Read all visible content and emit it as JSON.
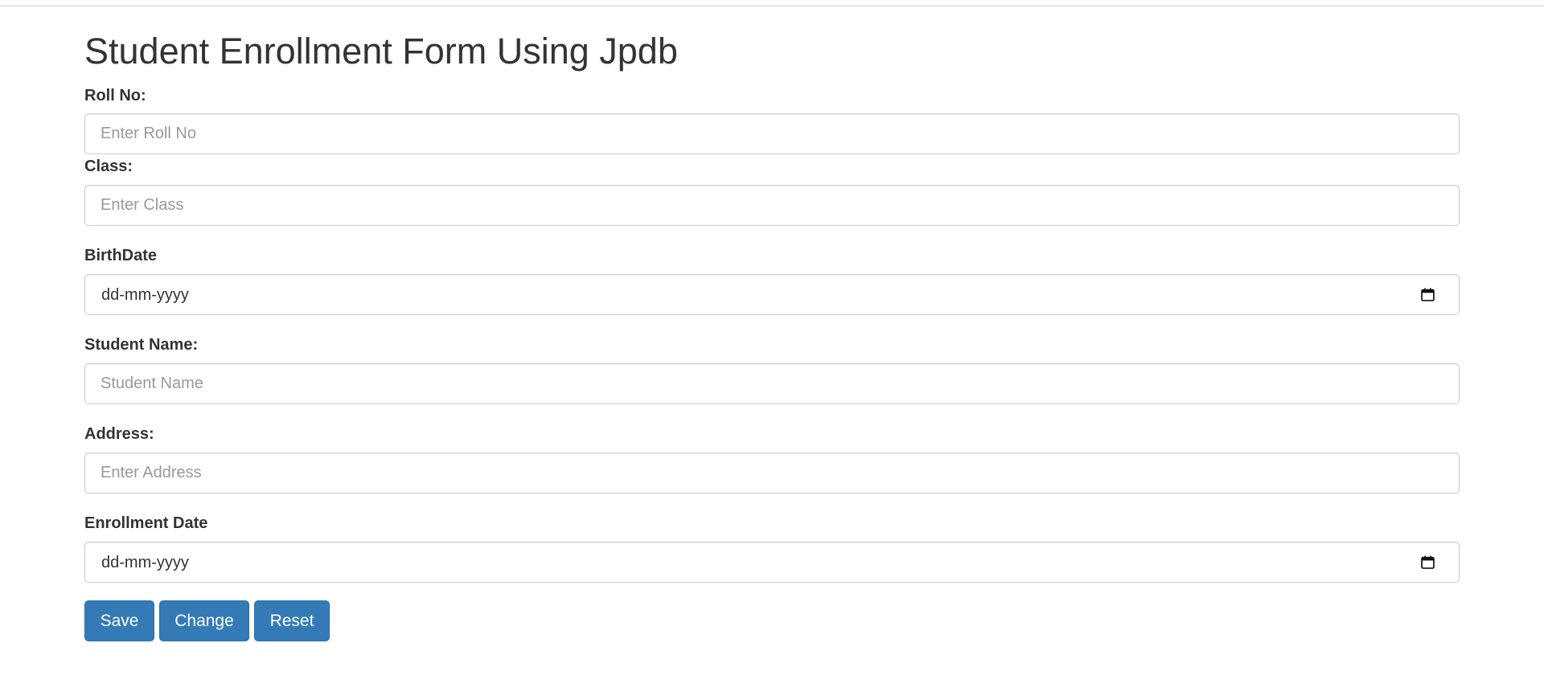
{
  "page": {
    "title": "Student Enrollment Form Using Jpdb"
  },
  "form": {
    "roll_no": {
      "label": "Roll No:",
      "placeholder": "Enter Roll No",
      "value": ""
    },
    "class": {
      "label": "Class:",
      "placeholder": "Enter Class",
      "value": ""
    },
    "birth_date": {
      "label": "BirthDate",
      "display_text": "dd-mm-yyyy"
    },
    "student_name": {
      "label": "Student Name:",
      "placeholder": "Student Name",
      "value": ""
    },
    "address": {
      "label": "Address:",
      "placeholder": "Enter Address",
      "value": ""
    },
    "enrollment_date": {
      "label": "Enrollment Date",
      "display_text": "dd-mm-yyyy"
    }
  },
  "buttons": {
    "save": "Save",
    "change": "Change",
    "reset": "Reset"
  },
  "icons": {
    "date_picker": "calendar-icon"
  },
  "colors": {
    "primary_button": "#337ab7",
    "primary_button_border": "#2e6da4",
    "text": "#333333",
    "placeholder": "#999999",
    "input_border": "#cccccc"
  }
}
